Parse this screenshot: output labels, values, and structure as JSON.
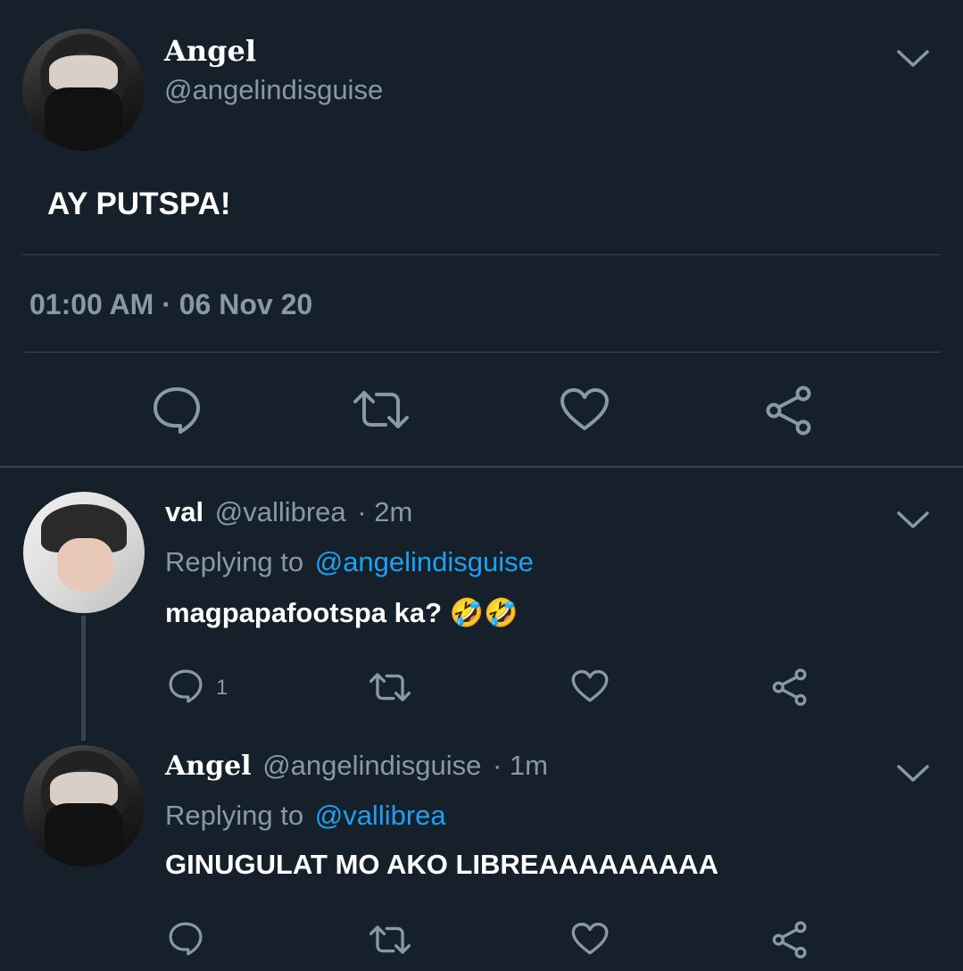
{
  "main_tweet": {
    "display_name": "Angel",
    "handle": "@angelindisguise",
    "text": "AY PUTSPA!",
    "timestamp": "01:00 AM · 06 Nov 20"
  },
  "replies": [
    {
      "display_name": "val",
      "handle": "@vallibrea",
      "age": "· 2m",
      "replying_label": "Replying to",
      "replying_to": "@angelindisguise",
      "text": "magpapafootspa ka? 🤣🤣",
      "reply_count": "1"
    },
    {
      "display_name": "Angel",
      "handle": "@angelindisguise",
      "age": "· 1m",
      "replying_label": "Replying to",
      "replying_to": "@vallibrea",
      "text": "GINUGULAT MO AKO LIBREAAAAAAAAA"
    }
  ],
  "icons": {
    "reply": "reply-icon",
    "retweet": "retweet-icon",
    "like": "heart-icon",
    "share": "share-icon",
    "more": "chevron-down-icon"
  },
  "colors": {
    "background": "#15202b",
    "text": "#ffffff",
    "muted": "#8899a6",
    "link": "#1da1f2",
    "divider": "#38444d"
  }
}
